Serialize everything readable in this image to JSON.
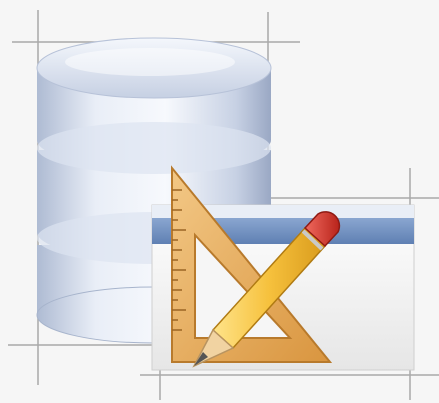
{
  "icon": {
    "semantic": "database-design-icon",
    "components": [
      "database-cylinder-icon",
      "window-form-icon",
      "set-square-icon",
      "pencil-icon",
      "guide-lines"
    ]
  },
  "colors": {
    "background": "#f6f6f6",
    "guide_line": "#a9a9a9",
    "db_light": "#eef2fa",
    "db_mid": "#c9d3e6",
    "db_dark": "#9aa8c4",
    "window_bar": "#6f8fbf",
    "window_body": "#f2f2f2",
    "triangle": "#e7b26a",
    "triangle_dark": "#c98a37",
    "pencil_body": "#f4c542",
    "pencil_tip": "#f1d3a2",
    "pencil_eraser": "#d9342b"
  }
}
